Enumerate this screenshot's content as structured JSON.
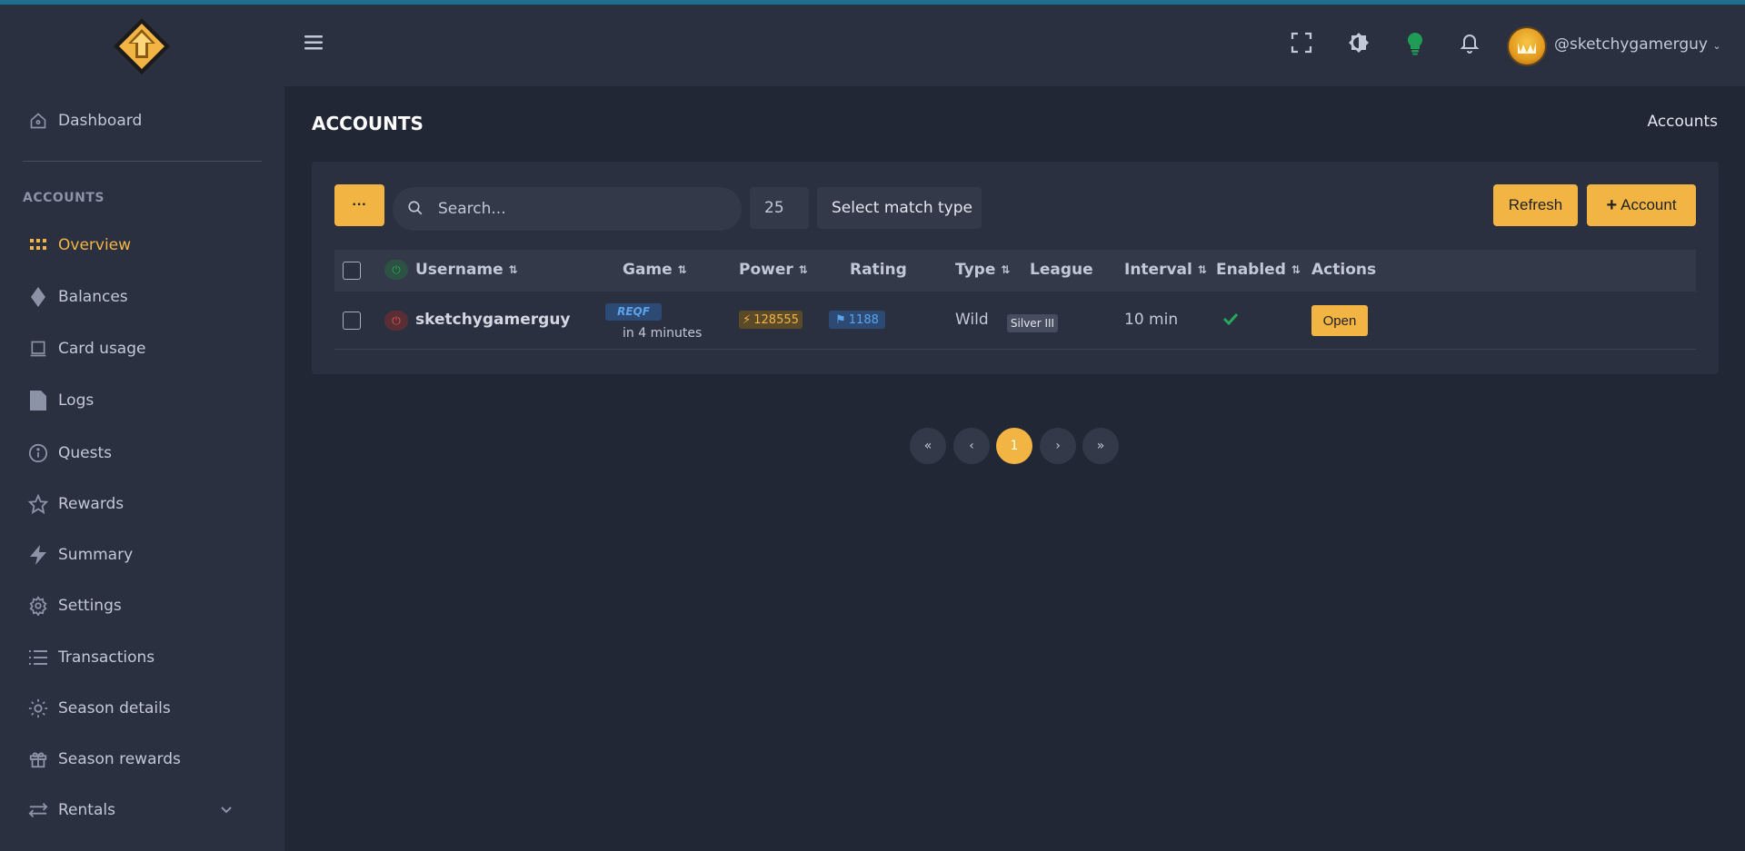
{
  "colors": {
    "accent": "#f2b544",
    "sidebar_bg": "#2b3040",
    "page_bg": "#222735",
    "enabled_check": "#28a85a",
    "bulb_green": "#1f9d55",
    "power_on": "#28a85a",
    "power_off": "#e05252"
  },
  "sidebar": {
    "section_label": "ACCOUNTS",
    "items": [
      {
        "label": "Dashboard",
        "icon": "home-icon"
      },
      {
        "label": "Overview",
        "icon": "grid-icon"
      },
      {
        "label": "Balances",
        "icon": "diamond-icon"
      },
      {
        "label": "Card usage",
        "icon": "card-icon"
      },
      {
        "label": "Logs",
        "icon": "file-icon"
      },
      {
        "label": "Quests",
        "icon": "info-icon"
      },
      {
        "label": "Rewards",
        "icon": "star-icon"
      },
      {
        "label": "Summary",
        "icon": "bolt-icon"
      },
      {
        "label": "Settings",
        "icon": "gear-icon"
      },
      {
        "label": "Transactions",
        "icon": "list-icon"
      },
      {
        "label": "Season details",
        "icon": "sun-icon"
      },
      {
        "label": "Season rewards",
        "icon": "gift-icon"
      },
      {
        "label": "Rentals",
        "icon": "swap-icon"
      }
    ]
  },
  "header": {
    "username": "@sketchygamerguy"
  },
  "page": {
    "title": "ACCOUNTS",
    "breadcrumb": "Accounts"
  },
  "toolbar": {
    "more_label": "···",
    "search_placeholder": "Search...",
    "per_page": "25",
    "match_type": "Select match type",
    "refresh_label": "Refresh",
    "add_account_label": "Account"
  },
  "table": {
    "columns": [
      "Username",
      "Game",
      "Power",
      "Rating",
      "Type",
      "League",
      "Interval",
      "Enabled",
      "Actions"
    ],
    "rows": [
      {
        "username": "sketchygamerguy",
        "game_badge": "REQF",
        "game_time": "in 4 minutes",
        "power": "128555",
        "rating": "1188",
        "type": "Wild",
        "league": "Silver III",
        "interval": "10 min",
        "enabled": true,
        "action_label": "Open"
      }
    ]
  },
  "pagination": {
    "first": "«",
    "prev": "‹",
    "current": "1",
    "next": "›",
    "last": "»"
  }
}
